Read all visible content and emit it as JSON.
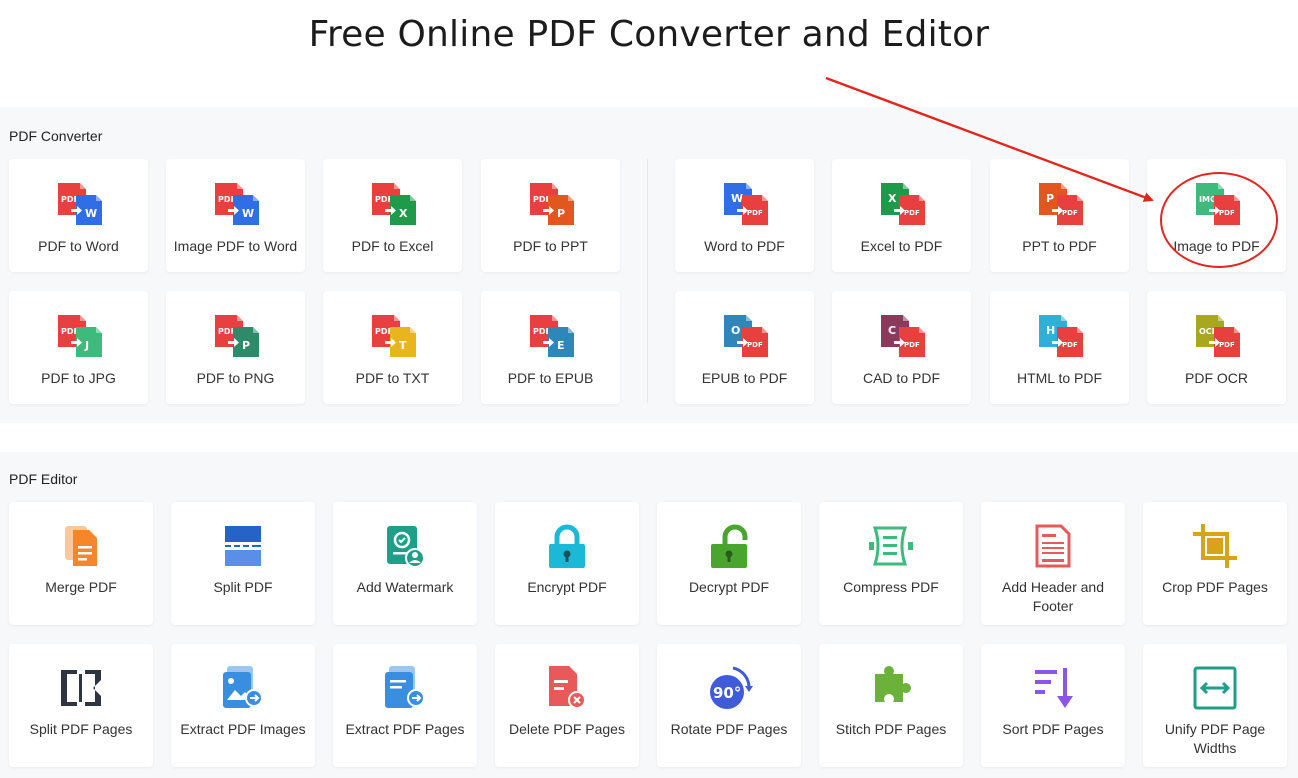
{
  "page": {
    "title": "Free Online PDF Converter and Editor"
  },
  "converter": {
    "label": "PDF Converter",
    "cards": [
      {
        "label": "PDF to Word",
        "from": "PDF",
        "to": "W",
        "toColor": "#2f6ee5"
      },
      {
        "label": "Image PDF to Word",
        "from": "PDF",
        "to": "W",
        "toColor": "#2f6ee5"
      },
      {
        "label": "PDF to Excel",
        "from": "PDF",
        "to": "X",
        "toColor": "#1f9a4b"
      },
      {
        "label": "PDF to PPT",
        "from": "PDF",
        "to": "P",
        "toColor": "#e2571e"
      },
      {
        "label": "Word to PDF",
        "from": "W",
        "fromColor": "#2f6ee5",
        "to": "PDF"
      },
      {
        "label": "Excel to PDF",
        "from": "X",
        "fromColor": "#1f9a4b",
        "to": "PDF"
      },
      {
        "label": "PPT to PDF",
        "from": "P",
        "fromColor": "#e2571e",
        "to": "PDF"
      },
      {
        "label": "Image to PDF",
        "from": "IMG",
        "fromColor": "#3dba7c",
        "to": "PDF"
      },
      {
        "label": "PDF to JPG",
        "from": "PDF",
        "to": "J",
        "toColor": "#3dba7c"
      },
      {
        "label": "PDF to PNG",
        "from": "PDF",
        "to": "P",
        "toColor": "#2f8a6a"
      },
      {
        "label": "PDF to TXT",
        "from": "PDF",
        "to": "T",
        "toColor": "#e8b51e"
      },
      {
        "label": "PDF to EPUB",
        "from": "PDF",
        "to": "E",
        "toColor": "#2f86b8"
      },
      {
        "label": "EPUB to PDF",
        "from": "O",
        "fromColor": "#2f86b8",
        "to": "PDF"
      },
      {
        "label": "CAD to PDF",
        "from": "C",
        "fromColor": "#8a3b5c",
        "to": "PDF"
      },
      {
        "label": "HTML to PDF",
        "from": "H",
        "fromColor": "#2fb0d8",
        "to": "PDF"
      },
      {
        "label": "PDF OCR",
        "from": "OCR",
        "fromColor": "#a8a81e",
        "to": "PDF"
      }
    ]
  },
  "editor": {
    "label": "PDF Editor",
    "cards": [
      {
        "label": "Merge PDF",
        "icon": "merge-pdf-icon",
        "color": "#f5862a"
      },
      {
        "label": "Split PDF",
        "icon": "split-pdf-icon",
        "color": "#2563c9"
      },
      {
        "label": "Add Watermark",
        "icon": "watermark-icon",
        "color": "#1f9e8a"
      },
      {
        "label": "Encrypt PDF",
        "icon": "lock-icon",
        "color": "#1cb8d8"
      },
      {
        "label": "Decrypt PDF",
        "icon": "unlock-icon",
        "color": "#4aa52e"
      },
      {
        "label": "Compress PDF",
        "icon": "compress-icon",
        "color": "#3dba7c"
      },
      {
        "label": "Add Header and Footer",
        "icon": "header-footer-icon",
        "color": "#e85a5a"
      },
      {
        "label": "Crop PDF Pages",
        "icon": "crop-icon",
        "color": "#d9a21b"
      },
      {
        "label": "Split PDF Pages",
        "icon": "split-pages-icon",
        "color": "#2e3440"
      },
      {
        "label": "Extract PDF Images",
        "icon": "extract-images-icon",
        "color": "#3a8ee0"
      },
      {
        "label": "Extract PDF Pages",
        "icon": "extract-pages-icon",
        "color": "#3a8ee0"
      },
      {
        "label": "Delete PDF Pages",
        "icon": "delete-pages-icon",
        "color": "#e85a5a"
      },
      {
        "label": "Rotate PDF Pages",
        "icon": "rotate-icon",
        "color": "#3f5bd8",
        "badge": "90°"
      },
      {
        "label": "Stitch PDF Pages",
        "icon": "puzzle-icon",
        "color": "#6bb23a"
      },
      {
        "label": "Sort PDF Pages",
        "icon": "sort-icon",
        "color": "#8a55e8"
      },
      {
        "label": "Unify PDF Page Widths",
        "icon": "unify-width-icon",
        "color": "#1f9e8a"
      }
    ]
  },
  "colors": {
    "pdfRed": "#e8403f",
    "annotation": "#e0271f",
    "sectionBg": "#f6f8fa"
  }
}
